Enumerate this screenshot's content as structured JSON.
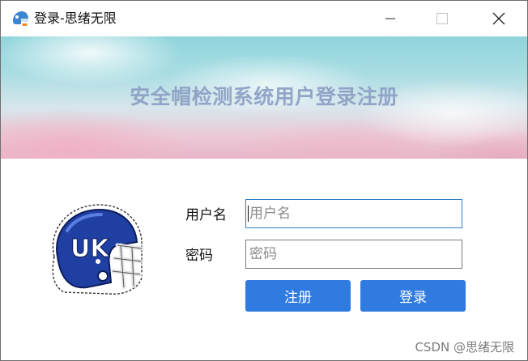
{
  "window": {
    "title": "登录-思绪无限",
    "icon": "helmet-app-icon",
    "controls": [
      "minimize-icon",
      "maximize-icon",
      "close-icon"
    ]
  },
  "banner": {
    "title": "安全帽检测系统用户登录注册"
  },
  "logo": {
    "icon": "helmet-logo-icon",
    "colors": {
      "shell": "#1f3fa3",
      "trim": "#ffffff"
    }
  },
  "form": {
    "username_label": "用户名",
    "username_placeholder": "用户名",
    "username_value": "",
    "password_label": "密码",
    "password_placeholder": "密码",
    "password_value": ""
  },
  "buttons": {
    "register_label": "注册",
    "login_label": "登录",
    "color": "#2f7be0"
  },
  "watermark": {
    "text": "CSDN @思绪无限"
  }
}
